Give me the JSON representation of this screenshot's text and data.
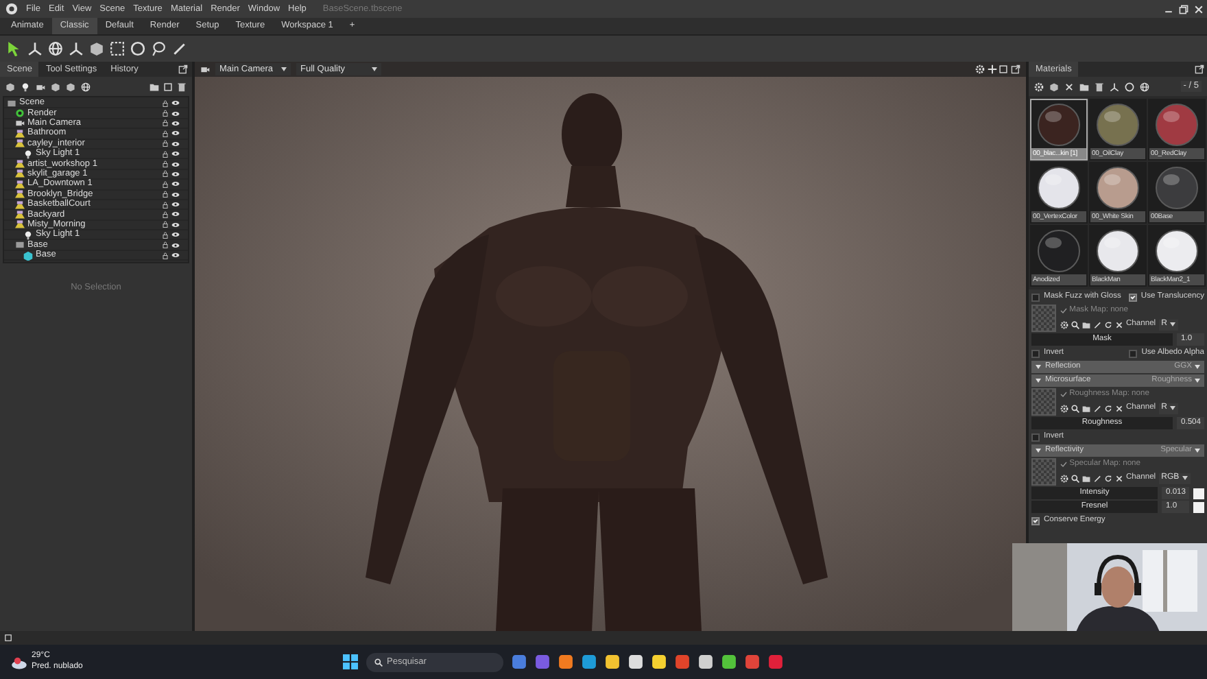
{
  "window": {
    "title": "BaseScene.tbscene"
  },
  "menu": [
    "File",
    "Edit",
    "View",
    "Scene",
    "Texture",
    "Material",
    "Render",
    "Window",
    "Help"
  ],
  "workspace_tabs": [
    {
      "label": "Animate",
      "selected": false
    },
    {
      "label": "Classic",
      "selected": true
    },
    {
      "label": "Default",
      "selected": false
    },
    {
      "label": "Render",
      "selected": false
    },
    {
      "label": "Setup",
      "selected": false
    },
    {
      "label": "Texture",
      "selected": false
    },
    {
      "label": "Workspace 1",
      "selected": false
    },
    {
      "label": "+",
      "selected": false
    }
  ],
  "left_panel": {
    "tabs": [
      {
        "label": "Scene",
        "selected": true
      },
      {
        "label": "Tool Settings",
        "selected": false
      },
      {
        "label": "History",
        "selected": false
      }
    ],
    "tree": [
      {
        "label": "Scene",
        "children": [
          {
            "label": "Render"
          },
          {
            "label": "Main Camera"
          },
          {
            "label": "Bathroom"
          },
          {
            "label": "cayley_interior",
            "children": [
              {
                "label": "Sky Light 1"
              }
            ]
          },
          {
            "label": "artist_workshop 1"
          },
          {
            "label": "skylit_garage 1"
          },
          {
            "label": "LA_Downtown 1"
          },
          {
            "label": "Brooklyn_Bridge"
          },
          {
            "label": "BasketballCourt"
          },
          {
            "label": "Backyard"
          },
          {
            "label": "Misty_Morning",
            "children": [
              {
                "label": "Sky Light 1"
              }
            ]
          },
          {
            "label": "Base",
            "children": [
              {
                "label": "Base"
              }
            ]
          }
        ]
      }
    ],
    "empty_message": "No Selection"
  },
  "viewport": {
    "camera": "Main Camera",
    "quality": "Full Quality"
  },
  "materials_panel": {
    "tab": "Materials",
    "search": "- / 5",
    "materials": [
      {
        "name": "00_blac...kin [1]",
        "color": "#3b2420",
        "selected": true
      },
      {
        "name": "00_OilClay",
        "color": "#77714f",
        "selected": false
      },
      {
        "name": "00_RedClay",
        "color": "#a03a42",
        "selected": false
      },
      {
        "name": "00_VertexColor",
        "color": "#e4e4ea",
        "selected": false
      },
      {
        "name": "00_White Skin",
        "color": "#b89c8e",
        "selected": false
      },
      {
        "name": "00Base",
        "color": "#3c3c3e",
        "selected": false
      },
      {
        "name": "Anodized",
        "color": "#202022",
        "selected": false
      },
      {
        "name": "BlackMan",
        "color": "#e8e8ec",
        "selected": false
      },
      {
        "name": "BlackMan2_1",
        "color": "#ececef",
        "selected": false
      }
    ]
  },
  "properties": [
    {
      "kind": "checkpair",
      "left": "Mask Fuzz with Gloss",
      "left_checked": false,
      "right": "Use Translucency",
      "right_checked": true
    },
    {
      "kind": "map",
      "label": "Mask Map: none",
      "channel_label": "Channel",
      "channel": "R"
    },
    {
      "kind": "slider",
      "label": "Mask",
      "value": "1.0"
    },
    {
      "kind": "checkpair",
      "left": "Invert",
      "left_checked": false,
      "right": "Use Albedo Alpha",
      "right_checked": false
    },
    {
      "kind": "section",
      "label": "Reflection",
      "mode": "GGX"
    },
    {
      "kind": "section",
      "label": "Microsurface",
      "mode": "Roughness"
    },
    {
      "kind": "map",
      "label": "Roughness Map: none",
      "channel_label": "Channel",
      "channel": "R"
    },
    {
      "kind": "slider",
      "label": "Roughness",
      "value": "0.504"
    },
    {
      "kind": "check",
      "label": "Invert",
      "checked": false
    },
    {
      "kind": "section",
      "label": "Reflectivity",
      "mode": "Specular"
    },
    {
      "kind": "map",
      "label": "Specular Map: none",
      "channel_label": "Channel",
      "channel": "RGB"
    },
    {
      "kind": "slider",
      "label": "Intensity",
      "value": "0.013",
      "swatch": true
    },
    {
      "kind": "slider",
      "label": "Fresnel",
      "value": "1.0",
      "swatch": true
    },
    {
      "kind": "check",
      "label": "Conserve Energy",
      "checked": true
    }
  ],
  "taskbar": {
    "temperature": "29°C",
    "forecast": "Pred. nublado",
    "search_placeholder": "Pesquisar"
  }
}
